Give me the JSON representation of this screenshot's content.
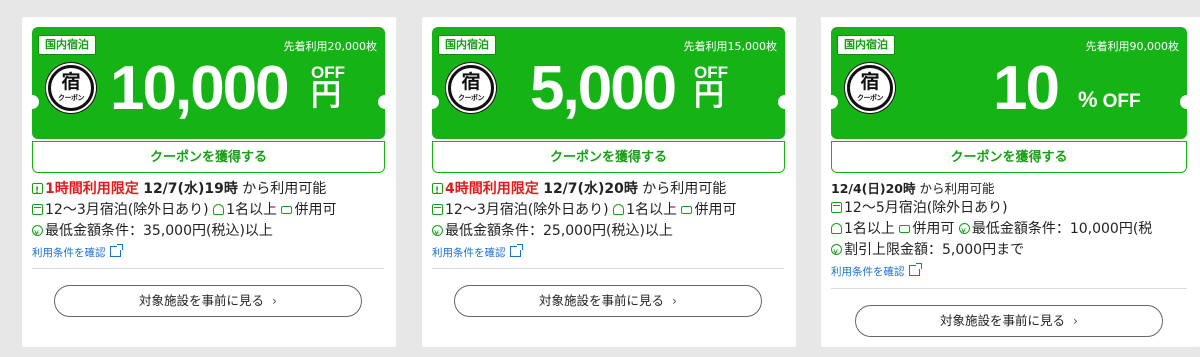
{
  "cards": [
    {
      "category": "国内宿泊",
      "limit_text": "先着利用20,000枚",
      "seal_kanji": "宿",
      "seal_sub": "クーポン",
      "amount": "10,000",
      "off_label": "OFF",
      "unit": "円",
      "get_button": "クーポンを獲得する",
      "time_limited": "1時間利用限定",
      "start_datetime": "12/7(水)19時",
      "available_from": "から利用可能",
      "stay_period": "12〜3月宿泊(除外日あり)",
      "people": "1名以上",
      "combinable": "併用可",
      "min_amount": "最低金額条件：35,000円(税込)以上",
      "terms_link": "利用条件を確認",
      "facility_button": "対象施設を事前に見る",
      "chevron": "›"
    },
    {
      "category": "国内宿泊",
      "limit_text": "先着利用15,000枚",
      "seal_kanji": "宿",
      "seal_sub": "クーポン",
      "amount": "5,000",
      "off_label": "OFF",
      "unit": "円",
      "get_button": "クーポンを獲得する",
      "time_limited": "4時間利用限定",
      "start_datetime": "12/7(水)20時",
      "available_from": "から利用可能",
      "stay_period": "12〜3月宿泊(除外日あり)",
      "people": "1名以上",
      "combinable": "併用可",
      "min_amount": "最低金額条件：25,000円(税込)以上",
      "terms_link": "利用条件を確認",
      "facility_button": "対象施設を事前に見る",
      "chevron": "›"
    },
    {
      "category": "国内宿泊",
      "limit_text": "先着利用90,000枚",
      "seal_kanji": "宿",
      "seal_sub": "クーポン",
      "amount": "10",
      "pct": "%",
      "off_label": "OFF",
      "get_button": "クーポンを獲得する",
      "start_datetime": "12/4(日)20時",
      "available_from": "から利用可能",
      "stay_period": "12〜5月宿泊(除外日あり)",
      "people": "1名以上",
      "combinable": "併用可",
      "min_amount": "最低金額条件：10,000円(税",
      "discount_cap": "割引上限金額：5,000円まで",
      "terms_link": "利用条件を確認",
      "facility_button": "対象施設を事前に見る",
      "chevron": "›"
    }
  ],
  "icons": {
    "alert": "alert-icon",
    "calendar": "calendar-icon",
    "person": "person-icon",
    "ticket": "ticket-icon",
    "yen": "yen-circle-icon",
    "external": "external-link-icon"
  },
  "colors": {
    "brand_green": "#16b316",
    "limited_red": "#e21c1c",
    "link_blue": "#1a6fd1",
    "background": "#e7e7e7"
  }
}
